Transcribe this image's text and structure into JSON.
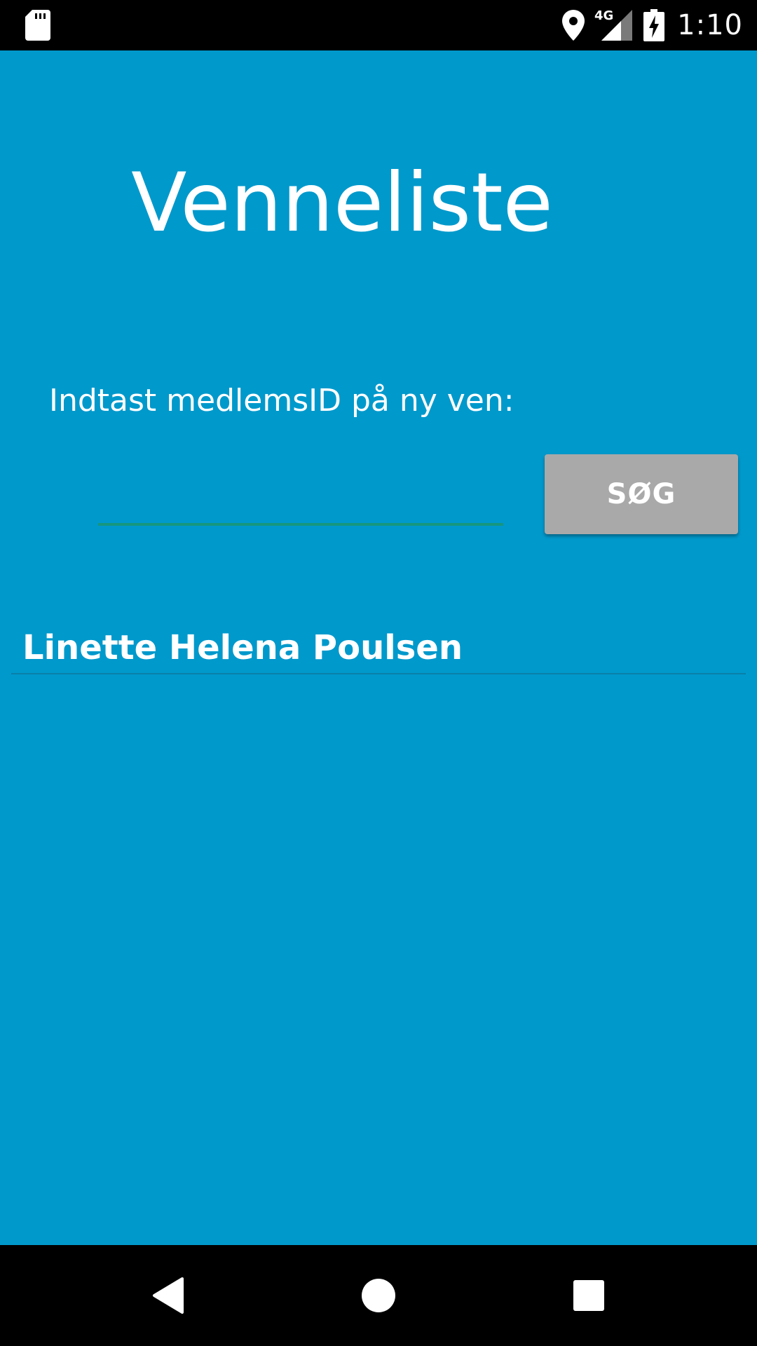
{
  "status_bar": {
    "time": "1:10",
    "network": "4G",
    "icons": [
      "sd-card-icon",
      "location-icon",
      "cellular-signal-icon",
      "battery-charging-icon"
    ]
  },
  "main": {
    "title": "Venneliste",
    "prompt": "Indtast medlemsID på ny ven:",
    "input": {
      "value": "",
      "placeholder": ""
    },
    "search_button_label": "SØG",
    "friends": [
      {
        "name": "Linette Helena Poulsen"
      }
    ]
  },
  "nav_bar": {
    "icons": [
      "back-icon",
      "home-icon",
      "recents-icon"
    ]
  },
  "colors": {
    "background": "#0099cc",
    "input_underline": "#16967f",
    "button": "#a9a9a9",
    "text": "#ffffff"
  }
}
